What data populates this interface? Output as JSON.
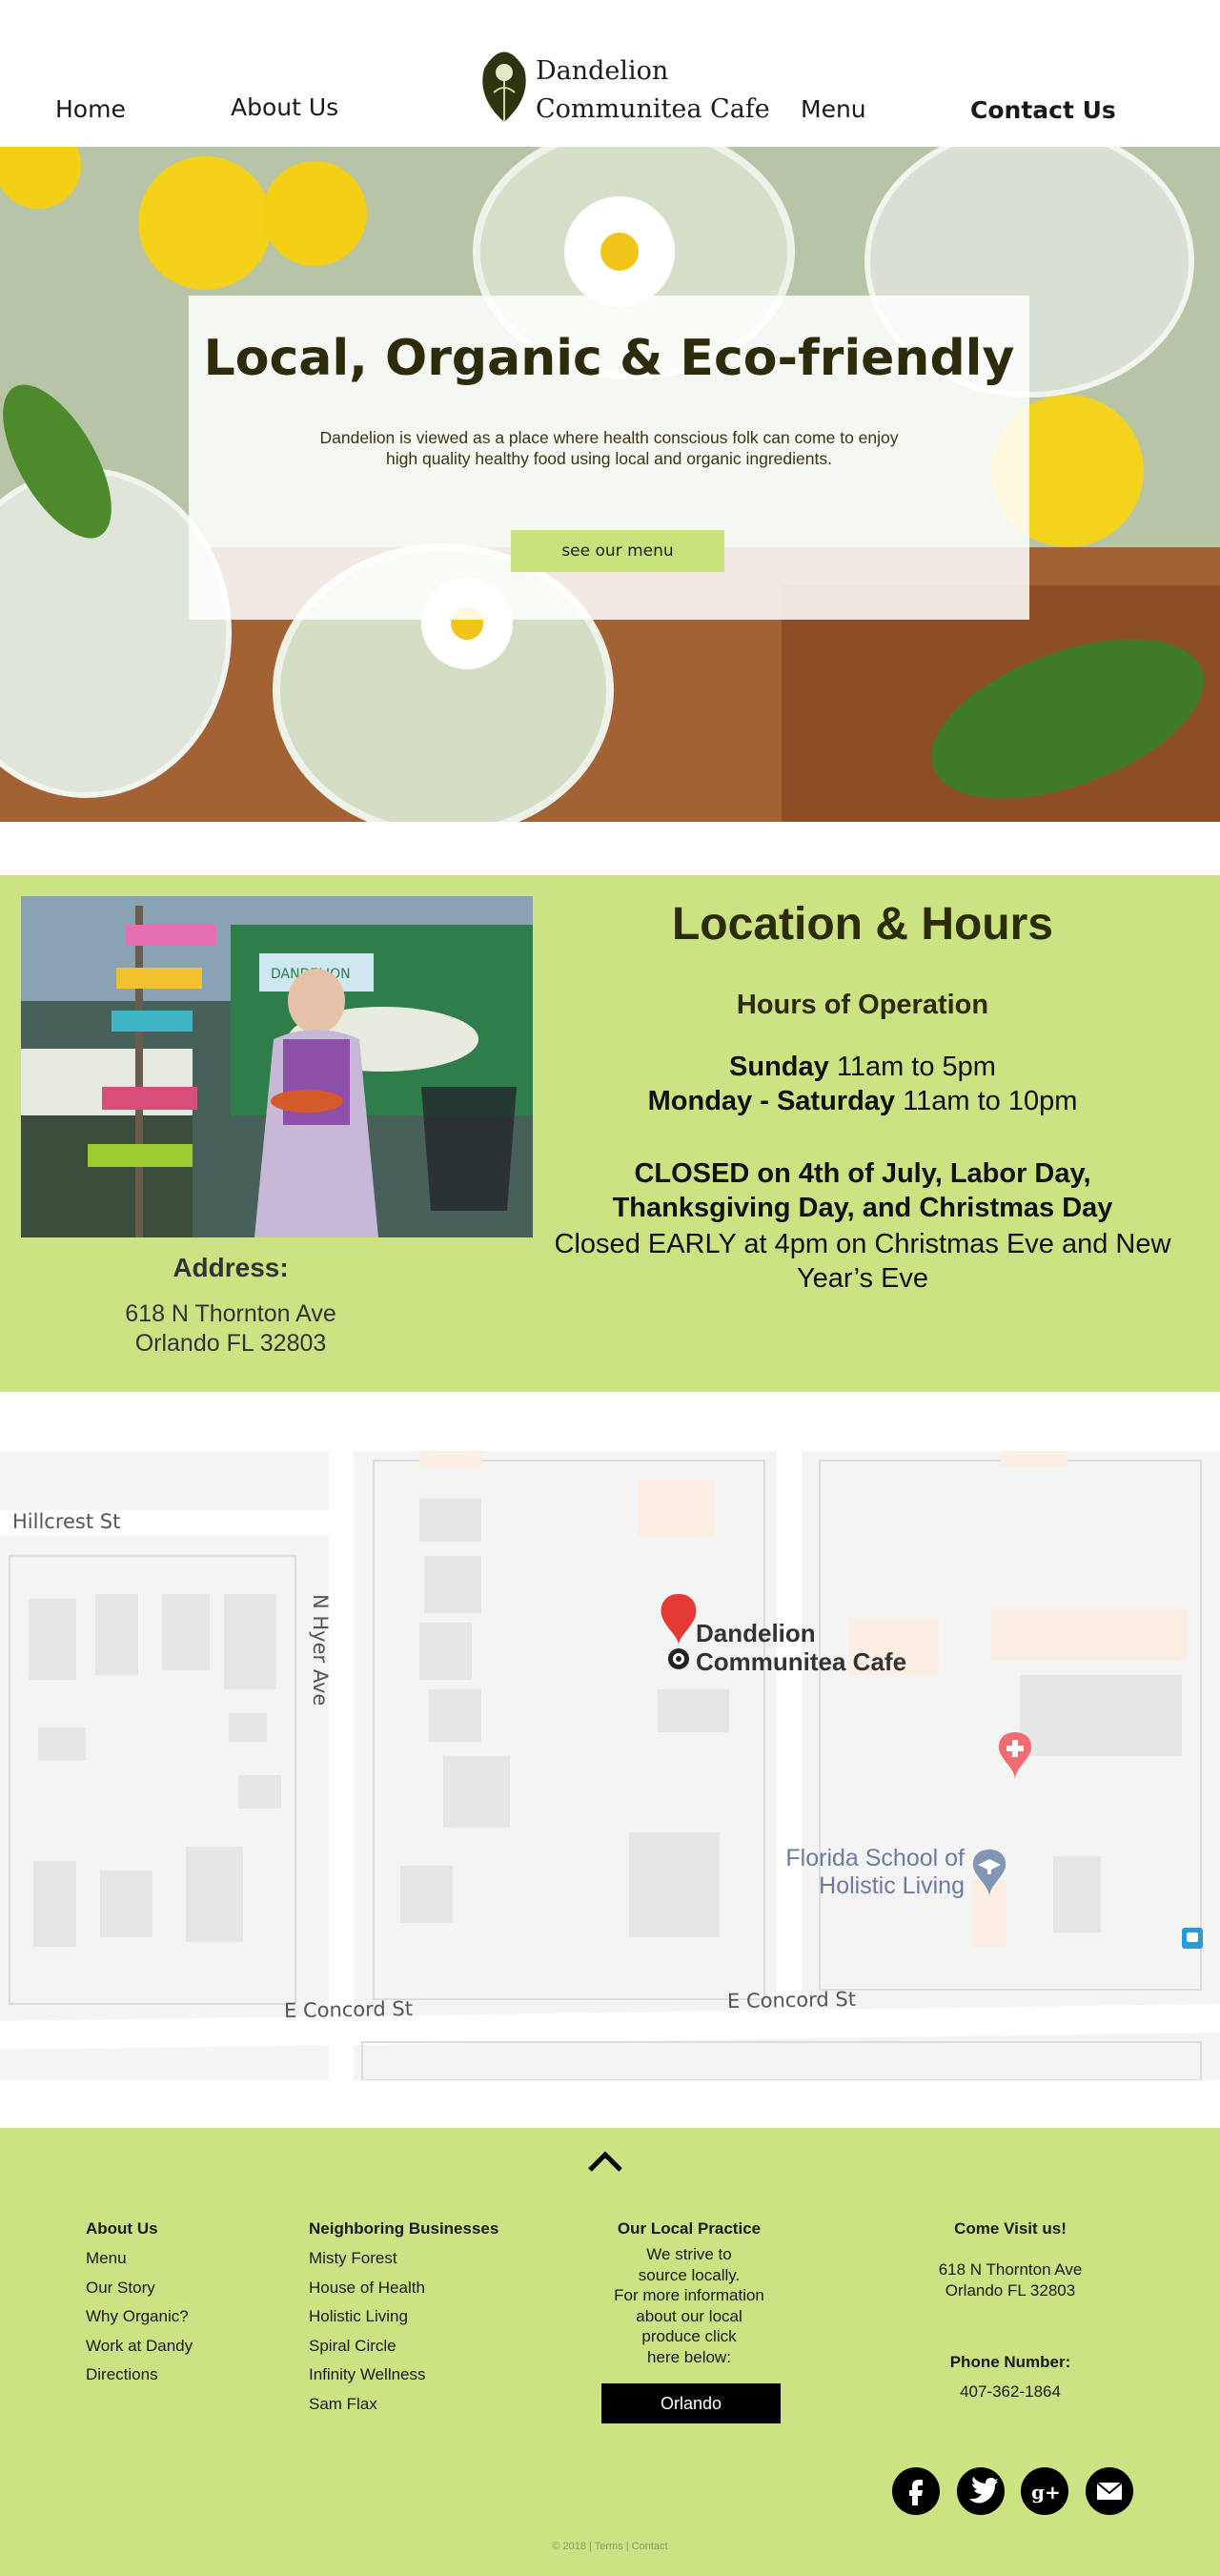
{
  "nav": {
    "home": "Home",
    "about": "About Us",
    "menu": "Menu",
    "contact": "Contact Us",
    "brand_line1": "Dandelion",
    "brand_line2": "Communitea Cafe"
  },
  "hero": {
    "title": "Local, Organic & Eco-friendly",
    "subtitle": "Dandelion is viewed as a place where health conscious folk can come to enjoy high quality healthy food using local and organic ingredients.",
    "button": "see our menu"
  },
  "location": {
    "title": "Location & Hours",
    "hours_heading": "Hours of Operation",
    "sunday_label": "Sunday",
    "sunday_hours": " 11am to 5pm",
    "weekday_label": "Monday - Saturday",
    "weekday_hours": " 11am to 10pm",
    "closed_line1": "CLOSED on 4th of July, Labor Day,",
    "closed_line2": "Thanksgiving Day, and Christmas Day",
    "early_close": "Closed EARLY at 4pm on Christmas Eve and New Year’s Eve",
    "address_heading": "Address:",
    "address_line1": "618 N Thornton Ave",
    "address_line2": "Orlando FL 32803",
    "photo_sign": "DANDELION"
  },
  "map": {
    "street_hillcrest": "Hillcrest St",
    "street_hyer": "N Hyer Ave",
    "street_concord_1": "E Concord St",
    "street_concord_2": "E Concord St",
    "place_line1": "Dandelion",
    "place_line2": "Communitea Cafe",
    "school_line1": "Florida School of",
    "school_line2": "Holistic Living"
  },
  "footer": {
    "col1": {
      "heading": "About Us",
      "items": [
        "Menu",
        "Our Story",
        "Why Organic?",
        "Work at Dandy",
        "Directions"
      ]
    },
    "col2": {
      "heading": "Neighboring Businesses",
      "items": [
        "Misty Forest",
        "House of Health",
        "Holistic Living",
        "Spiral Circle",
        "Infinity Wellness",
        "Sam Flax"
      ]
    },
    "col3": {
      "heading": "Our Local Practice",
      "lines": [
        "We strive to",
        "source locally.",
        "For more information",
        "about our local",
        "produce click",
        "here below:"
      ],
      "button": "Orlando"
    },
    "col4": {
      "heading": "Come Visit us!",
      "address_line1": "618 N Thornton Ave",
      "address_line2": "Orlando FL 32803",
      "phone_heading": "Phone Number:",
      "phone": "407-362-1864"
    },
    "social_icons": [
      "facebook-icon",
      "twitter-icon",
      "google-plus-icon",
      "email-icon"
    ],
    "copyright": "© 2018 | Terms | Contact"
  },
  "colors": {
    "accent_green": "#cbe383",
    "button_green": "#c9e37c",
    "dark_olive": "#2d2b0a",
    "map_pin_red": "#e53935"
  }
}
